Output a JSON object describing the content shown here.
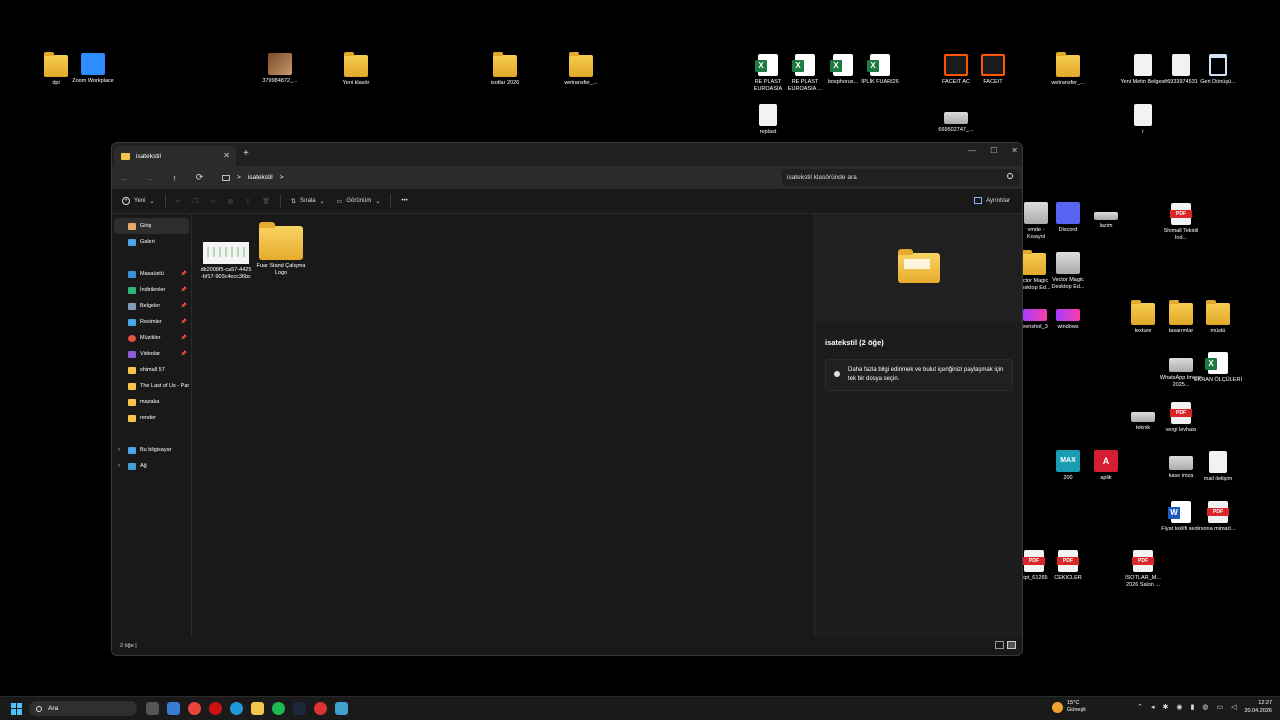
{
  "desktop": {
    "icons": [
      {
        "label": "dpi",
        "type": "folder"
      },
      {
        "label": "Zoom Workplace",
        "type": "zoom"
      },
      {
        "label": "379984872_...",
        "type": "photo"
      },
      {
        "label": "Yeni klasör",
        "type": "folder"
      },
      {
        "label": "isotlar 2026",
        "type": "folder"
      },
      {
        "label": "wetransfer_...",
        "type": "folder"
      },
      {
        "label": "RE PLAST EUROASİA",
        "type": "excel"
      },
      {
        "label": "RE PLAST EUROASİA ...",
        "type": "excel"
      },
      {
        "label": "bosphorus...",
        "type": "excel"
      },
      {
        "label": "İPLİK FUARI26",
        "type": "excel"
      },
      {
        "label": "FACEIT AC",
        "type": "faceit"
      },
      {
        "label": "FACEIT",
        "type": "faceit"
      },
      {
        "label": "wetransfer_...",
        "type": "folder"
      },
      {
        "label": "Yeni Metin Belgesi",
        "type": "doc"
      },
      {
        "label": "#6933974531",
        "type": "doc"
      },
      {
        "label": "Geri Dönüşü...",
        "type": "bin"
      },
      {
        "label": "replast",
        "type": "doc"
      },
      {
        "label": "669502747_...",
        "type": "img"
      },
      {
        "label": "r",
        "type": "doc"
      },
      {
        "label": "vmde - Kısayol",
        "type": "img"
      },
      {
        "label": "Discord",
        "type": "discord"
      },
      {
        "label": "lazim",
        "type": "img"
      },
      {
        "label": "Shimall Tekstil Ind...",
        "type": "pdf"
      },
      {
        "label": "ector Magic Desktop Ed...",
        "type": "folder"
      },
      {
        "label": "Vector Magic Desktop Ed...",
        "type": "img"
      },
      {
        "label": "eenshot_3",
        "type": "purple"
      },
      {
        "label": "windows",
        "type": "purple"
      },
      {
        "label": "texture",
        "type": "folder"
      },
      {
        "label": "tasarımlar",
        "type": "folder"
      },
      {
        "label": "müstü",
        "type": "folder"
      },
      {
        "label": "WhatsApp Image 2025...",
        "type": "img"
      },
      {
        "label": "EKRAN ÖLÇÜLERİ",
        "type": "excel"
      },
      {
        "label": "teknik",
        "type": "img"
      },
      {
        "label": "vergi levhası",
        "type": "pdf"
      },
      {
        "label": "200",
        "type": "max"
      },
      {
        "label": "aplik",
        "type": "aplik"
      },
      {
        "label": "kase imza",
        "type": "img"
      },
      {
        "label": "mail iletişim",
        "type": "doc"
      },
      {
        "label": "Fiyat teklifi sedir",
        "type": "word"
      },
      {
        "label": "sona mimarl...",
        "type": "pdf"
      },
      {
        "label": "eipt_61265",
        "type": "pdf"
      },
      {
        "label": "CEKICLER",
        "type": "pdf"
      },
      {
        "label": "İSOTLAR_M... 2026 Salon ...",
        "type": "pdf"
      }
    ]
  },
  "explorer": {
    "tab_title": "isatekstil",
    "tab_close": "✕",
    "new_tab": "+",
    "window_controls": {
      "minimize": "—",
      "maximize": "☐",
      "close": "✕"
    },
    "nav": {
      "back": "←",
      "forward": "→",
      "up": "↑",
      "refresh": "⟳"
    },
    "address": {
      "sep": ">",
      "path": "isatekstil",
      "trail": ">"
    },
    "search_placeholder": "isatekstil klasöründe ara",
    "toolbar": {
      "new_label": "Yeni",
      "sort_label": "Sırala",
      "view_label": "Görünüm",
      "more_label": "•••",
      "details_label": "Ayrıntılar"
    },
    "sidebar": {
      "items": [
        {
          "label": "Giriş",
          "icon": "home",
          "pinned": false
        },
        {
          "label": "Galeri",
          "icon": "gallery",
          "pinned": false
        },
        {
          "label": "Masaüstü",
          "icon": "desktop",
          "pinned": true
        },
        {
          "label": "İndirilenler",
          "icon": "download",
          "pinned": true
        },
        {
          "label": "Belgeler",
          "icon": "documents",
          "pinned": true
        },
        {
          "label": "Resimler",
          "icon": "pictures",
          "pinned": true
        },
        {
          "label": "Müzikler",
          "icon": "music",
          "pinned": true
        },
        {
          "label": "Videolar",
          "icon": "videos",
          "pinned": true
        },
        {
          "label": "shimall 57",
          "icon": "folder",
          "pinned": false
        },
        {
          "label": "The Last of Us - Par",
          "icon": "folder",
          "pinned": false
        },
        {
          "label": "mazaka",
          "icon": "folder",
          "pinned": false
        },
        {
          "label": "render",
          "icon": "folder",
          "pinned": false
        },
        {
          "label": "Bu bilgisayar",
          "icon": "pc",
          "pinned": false
        },
        {
          "label": "Ağ",
          "icon": "network",
          "pinned": false
        }
      ]
    },
    "files": [
      {
        "name": "db2008f5-ca57-4425-bf17-903c4ecc36bc",
        "type": "image"
      },
      {
        "name": "Fuar Stand Çalışma Logo",
        "type": "folder"
      }
    ],
    "preview": {
      "title": "isatekstil (2 öğe)",
      "info": "Daha fazla bilgi edinmek ve bulut içeriğinizi paylaşmak için tek bir dosya seçin."
    },
    "status": "2 öğe  |"
  },
  "taskbar": {
    "search_label": "Ara",
    "weather_temp": "15°C",
    "weather_desc": "Güneşli",
    "time": "12:27",
    "date": "20.04.2026"
  }
}
